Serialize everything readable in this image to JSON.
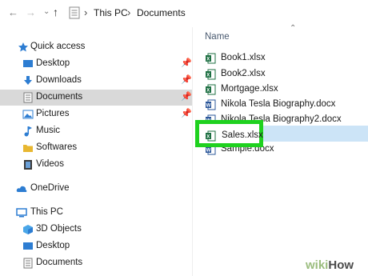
{
  "toolbar": {
    "back_icon": "arrow-left",
    "forward_icon": "arrow-right",
    "dropdown_icon": "chevron-down",
    "up_icon": "arrow-up"
  },
  "breadcrumb": {
    "items": [
      "This PC",
      "Documents"
    ]
  },
  "sidebar": {
    "items": [
      {
        "label": "Quick access",
        "icon": "star-icon"
      },
      {
        "label": "Desktop",
        "icon": "desktop-icon",
        "pinned": true
      },
      {
        "label": "Downloads",
        "icon": "download-icon",
        "pinned": true
      },
      {
        "label": "Documents",
        "icon": "documents-icon",
        "pinned": true,
        "selected": true
      },
      {
        "label": "Pictures",
        "icon": "pictures-icon",
        "pinned": true
      },
      {
        "label": "Music",
        "icon": "music-icon"
      },
      {
        "label": "Softwares",
        "icon": "folder-icon"
      },
      {
        "label": "Videos",
        "icon": "videos-icon"
      },
      {
        "label": "OneDrive",
        "icon": "cloud-icon"
      },
      {
        "label": "This PC",
        "icon": "computer-icon"
      },
      {
        "label": "3D Objects",
        "icon": "cube-icon"
      },
      {
        "label": "Desktop",
        "icon": "desktop-icon"
      },
      {
        "label": "Documents",
        "icon": "documents-icon"
      }
    ]
  },
  "files": {
    "column_header": "Name",
    "items": [
      {
        "name": "Book1.xlsx",
        "type": "excel"
      },
      {
        "name": "Book2.xlsx",
        "type": "excel"
      },
      {
        "name": "Mortgage.xlsx",
        "type": "excel"
      },
      {
        "name": "Nikola Tesla Biography.docx",
        "type": "word"
      },
      {
        "name": "Nikola Tesla Biography2.docx",
        "type": "word"
      },
      {
        "name": "Sales.xlsx",
        "type": "excel",
        "selected": true
      },
      {
        "name": "Sample.docx",
        "type": "word"
      }
    ]
  },
  "colors": {
    "selection_blue": "#cce4f7",
    "sidebar_selected": "#d9d9d9",
    "highlight_green": "#1fd11f",
    "excel_green": "#1d6f42",
    "word_blue": "#2b579a"
  },
  "watermark": {
    "wiki": "wiki",
    "how": "How"
  }
}
